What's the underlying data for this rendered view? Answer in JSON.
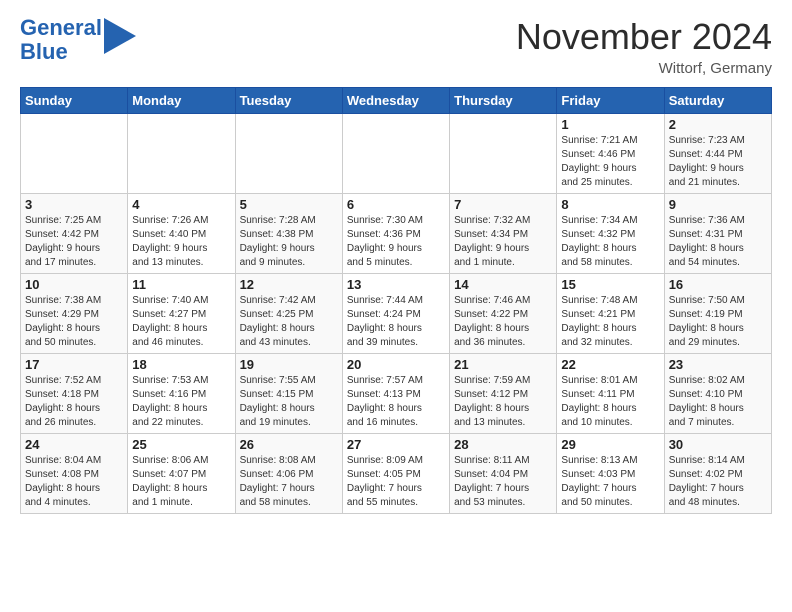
{
  "header": {
    "logo_line1": "General",
    "logo_line2": "Blue",
    "month_title": "November 2024",
    "location": "Wittorf, Germany"
  },
  "weekdays": [
    "Sunday",
    "Monday",
    "Tuesday",
    "Wednesday",
    "Thursday",
    "Friday",
    "Saturday"
  ],
  "weeks": [
    [
      {
        "day": "",
        "info": ""
      },
      {
        "day": "",
        "info": ""
      },
      {
        "day": "",
        "info": ""
      },
      {
        "day": "",
        "info": ""
      },
      {
        "day": "",
        "info": ""
      },
      {
        "day": "1",
        "info": "Sunrise: 7:21 AM\nSunset: 4:46 PM\nDaylight: 9 hours\nand 25 minutes."
      },
      {
        "day": "2",
        "info": "Sunrise: 7:23 AM\nSunset: 4:44 PM\nDaylight: 9 hours\nand 21 minutes."
      }
    ],
    [
      {
        "day": "3",
        "info": "Sunrise: 7:25 AM\nSunset: 4:42 PM\nDaylight: 9 hours\nand 17 minutes."
      },
      {
        "day": "4",
        "info": "Sunrise: 7:26 AM\nSunset: 4:40 PM\nDaylight: 9 hours\nand 13 minutes."
      },
      {
        "day": "5",
        "info": "Sunrise: 7:28 AM\nSunset: 4:38 PM\nDaylight: 9 hours\nand 9 minutes."
      },
      {
        "day": "6",
        "info": "Sunrise: 7:30 AM\nSunset: 4:36 PM\nDaylight: 9 hours\nand 5 minutes."
      },
      {
        "day": "7",
        "info": "Sunrise: 7:32 AM\nSunset: 4:34 PM\nDaylight: 9 hours\nand 1 minute."
      },
      {
        "day": "8",
        "info": "Sunrise: 7:34 AM\nSunset: 4:32 PM\nDaylight: 8 hours\nand 58 minutes."
      },
      {
        "day": "9",
        "info": "Sunrise: 7:36 AM\nSunset: 4:31 PM\nDaylight: 8 hours\nand 54 minutes."
      }
    ],
    [
      {
        "day": "10",
        "info": "Sunrise: 7:38 AM\nSunset: 4:29 PM\nDaylight: 8 hours\nand 50 minutes."
      },
      {
        "day": "11",
        "info": "Sunrise: 7:40 AM\nSunset: 4:27 PM\nDaylight: 8 hours\nand 46 minutes."
      },
      {
        "day": "12",
        "info": "Sunrise: 7:42 AM\nSunset: 4:25 PM\nDaylight: 8 hours\nand 43 minutes."
      },
      {
        "day": "13",
        "info": "Sunrise: 7:44 AM\nSunset: 4:24 PM\nDaylight: 8 hours\nand 39 minutes."
      },
      {
        "day": "14",
        "info": "Sunrise: 7:46 AM\nSunset: 4:22 PM\nDaylight: 8 hours\nand 36 minutes."
      },
      {
        "day": "15",
        "info": "Sunrise: 7:48 AM\nSunset: 4:21 PM\nDaylight: 8 hours\nand 32 minutes."
      },
      {
        "day": "16",
        "info": "Sunrise: 7:50 AM\nSunset: 4:19 PM\nDaylight: 8 hours\nand 29 minutes."
      }
    ],
    [
      {
        "day": "17",
        "info": "Sunrise: 7:52 AM\nSunset: 4:18 PM\nDaylight: 8 hours\nand 26 minutes."
      },
      {
        "day": "18",
        "info": "Sunrise: 7:53 AM\nSunset: 4:16 PM\nDaylight: 8 hours\nand 22 minutes."
      },
      {
        "day": "19",
        "info": "Sunrise: 7:55 AM\nSunset: 4:15 PM\nDaylight: 8 hours\nand 19 minutes."
      },
      {
        "day": "20",
        "info": "Sunrise: 7:57 AM\nSunset: 4:13 PM\nDaylight: 8 hours\nand 16 minutes."
      },
      {
        "day": "21",
        "info": "Sunrise: 7:59 AM\nSunset: 4:12 PM\nDaylight: 8 hours\nand 13 minutes."
      },
      {
        "day": "22",
        "info": "Sunrise: 8:01 AM\nSunset: 4:11 PM\nDaylight: 8 hours\nand 10 minutes."
      },
      {
        "day": "23",
        "info": "Sunrise: 8:02 AM\nSunset: 4:10 PM\nDaylight: 8 hours\nand 7 minutes."
      }
    ],
    [
      {
        "day": "24",
        "info": "Sunrise: 8:04 AM\nSunset: 4:08 PM\nDaylight: 8 hours\nand 4 minutes."
      },
      {
        "day": "25",
        "info": "Sunrise: 8:06 AM\nSunset: 4:07 PM\nDaylight: 8 hours\nand 1 minute."
      },
      {
        "day": "26",
        "info": "Sunrise: 8:08 AM\nSunset: 4:06 PM\nDaylight: 7 hours\nand 58 minutes."
      },
      {
        "day": "27",
        "info": "Sunrise: 8:09 AM\nSunset: 4:05 PM\nDaylight: 7 hours\nand 55 minutes."
      },
      {
        "day": "28",
        "info": "Sunrise: 8:11 AM\nSunset: 4:04 PM\nDaylight: 7 hours\nand 53 minutes."
      },
      {
        "day": "29",
        "info": "Sunrise: 8:13 AM\nSunset: 4:03 PM\nDaylight: 7 hours\nand 50 minutes."
      },
      {
        "day": "30",
        "info": "Sunrise: 8:14 AM\nSunset: 4:02 PM\nDaylight: 7 hours\nand 48 minutes."
      }
    ]
  ]
}
